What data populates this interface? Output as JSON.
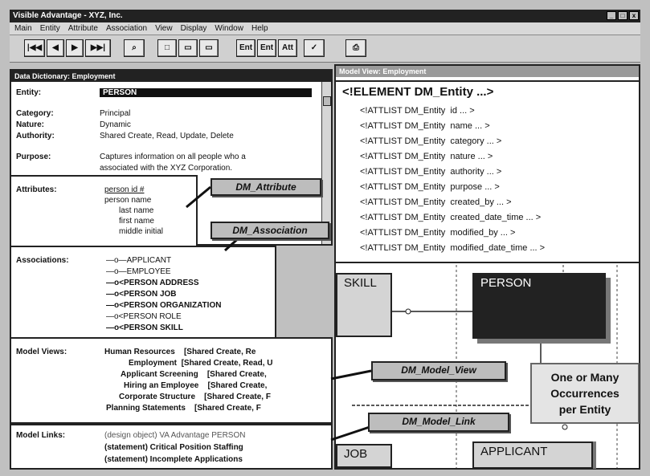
{
  "app": {
    "title": "Visible Advantage - XYZ, Inc."
  },
  "menu": [
    "Main",
    "Entity",
    "Attribute",
    "Association",
    "View",
    "Display",
    "Window",
    "Help"
  ],
  "toolbar": {
    "first": "|◀◀",
    "prev": "◀",
    "next": "▶",
    "last": "▶▶|",
    "find": "⌕",
    "box1": "□",
    "box2": "▭",
    "box3": "▭",
    "ent1": "Ent",
    "ent2": "Ent",
    "ent3": "Att",
    "check": "✓",
    "print": "⎙"
  },
  "dictionary": {
    "title": "Data Dictionary: Employment",
    "entity_label": "Entity:",
    "entity_value": "PERSON",
    "category_label": "Category:",
    "category_value": "Principal",
    "nature_label": "Nature:",
    "nature_value": "Dynamic",
    "authority_label": "Authority:",
    "authority_value": "Shared Create, Read, Update, Delete",
    "purpose_label": "Purpose:",
    "purpose_line1": "Captures information on all people who a",
    "purpose_line2": "associated with the XYZ Corporation.",
    "attributes_label": "Attributes:",
    "attributes": [
      "person id #",
      "person name",
      "last name",
      "first name",
      "middle initial"
    ],
    "associations_label": "Associations:",
    "associations": [
      "APPLICANT",
      "EMPLOYEE",
      "PERSON ADDRESS",
      "PERSON JOB",
      "PERSON ORGANIZATION",
      "PERSON ROLE",
      "PERSON SKILL"
    ],
    "model_views_label": "Model Views:",
    "model_views": [
      [
        "Human Resources",
        "[Shared Create, Re"
      ],
      [
        "Employment",
        "[Shared Create, Read, U"
      ],
      [
        "Applicant Screening",
        "[Shared Create,"
      ],
      [
        "Hiring an Employee",
        "[Shared Create,"
      ],
      [
        "Corporate Structure",
        "[Shared Create, F"
      ],
      [
        "Planning Statements",
        "[Shared Create, F"
      ]
    ],
    "model_links_label": "Model Links:",
    "model_links": [
      "(design object) VA Advantage PERSON",
      "(statement) Critical Position Staffing",
      "(statement) Incomplete Applications"
    ]
  },
  "diagram_window": {
    "title": "Model View: Employment"
  },
  "xml": {
    "head": "<!ELEMENT DM_Entity  ...>",
    "attlists": [
      [
        "<!ATTLIST DM_Entity",
        "id ... >"
      ],
      [
        "<!ATTLIST DM_Entity",
        "name ... >"
      ],
      [
        "<!ATTLIST DM_Entity",
        "category ... >"
      ],
      [
        "<!ATTLIST DM_Entity",
        "nature ... >"
      ],
      [
        "<!ATTLIST DM_Entity",
        "authority ... >"
      ],
      [
        "<!ATTLIST DM_Entity",
        "purpose ... >"
      ],
      [
        "<!ATTLIST DM_Entity",
        "created_by ... >"
      ],
      [
        "<!ATTLIST DM_Entity",
        "created_date_time ... >"
      ],
      [
        "<!ATTLIST DM_Entity",
        "modified_by ... >"
      ],
      [
        "<!ATTLIST DM_Entity",
        "modified_date_time ... >"
      ]
    ]
  },
  "callouts": {
    "attribute": "DM_Attribute",
    "association": "DM_Association",
    "model_view": "DM_Model_View",
    "model_link": "DM_Model_Link"
  },
  "entities": {
    "skill": "SKILL",
    "person": "PERSON",
    "job": "JOB",
    "applicant": "APPLICANT"
  },
  "note": {
    "line1": "One or Many",
    "line2": "Occurrences",
    "line3": "per Entity"
  }
}
